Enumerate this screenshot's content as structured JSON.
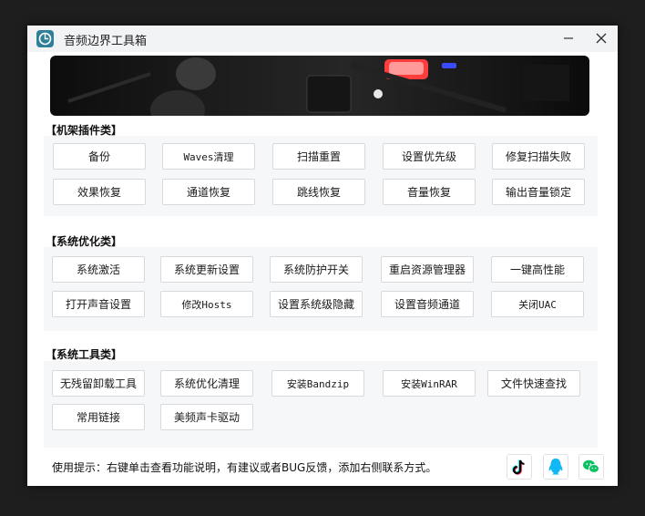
{
  "window": {
    "title": "音频边界工具箱",
    "app_icon": "app-logo-icon",
    "minimize_icon": "minimize-icon",
    "close_icon": "close-icon"
  },
  "sections": {
    "rack": {
      "title": "【机架插件类】",
      "buttons": [
        "备份",
        "Waves清理",
        "扫描重置",
        "设置优先级",
        "修复扫描失败",
        "效果恢复",
        "通道恢复",
        "跳线恢复",
        "音量恢复",
        "输出音量锁定"
      ]
    },
    "system_opt": {
      "title": "【系统优化类】",
      "buttons": [
        "系统激活",
        "系统更新设置",
        "系统防护开关",
        "重启资源管理器",
        "一键高性能",
        "打开声音设置",
        "修改Hosts",
        "设置系统级隐藏",
        "设置音频通道",
        "关闭UAC"
      ]
    },
    "system_tools": {
      "title": "【系统工具类】",
      "buttons": [
        "无残留卸载工具",
        "系统优化清理",
        "安装Bandzip",
        "安装WinRAR",
        "文件快速查找",
        "常用链接",
        "美频声卡驱动"
      ]
    }
  },
  "footer": {
    "hint": "使用提示：右键单击查看功能说明，有建议或者BUG反馈，添加右侧联系方式。",
    "contacts": [
      "tiktok-icon",
      "qq-icon",
      "wechat-icon"
    ]
  },
  "colors": {
    "accent": "#2f7f98",
    "panel_bg": "#f6f7f9",
    "button_border": "#d7d9dc"
  }
}
